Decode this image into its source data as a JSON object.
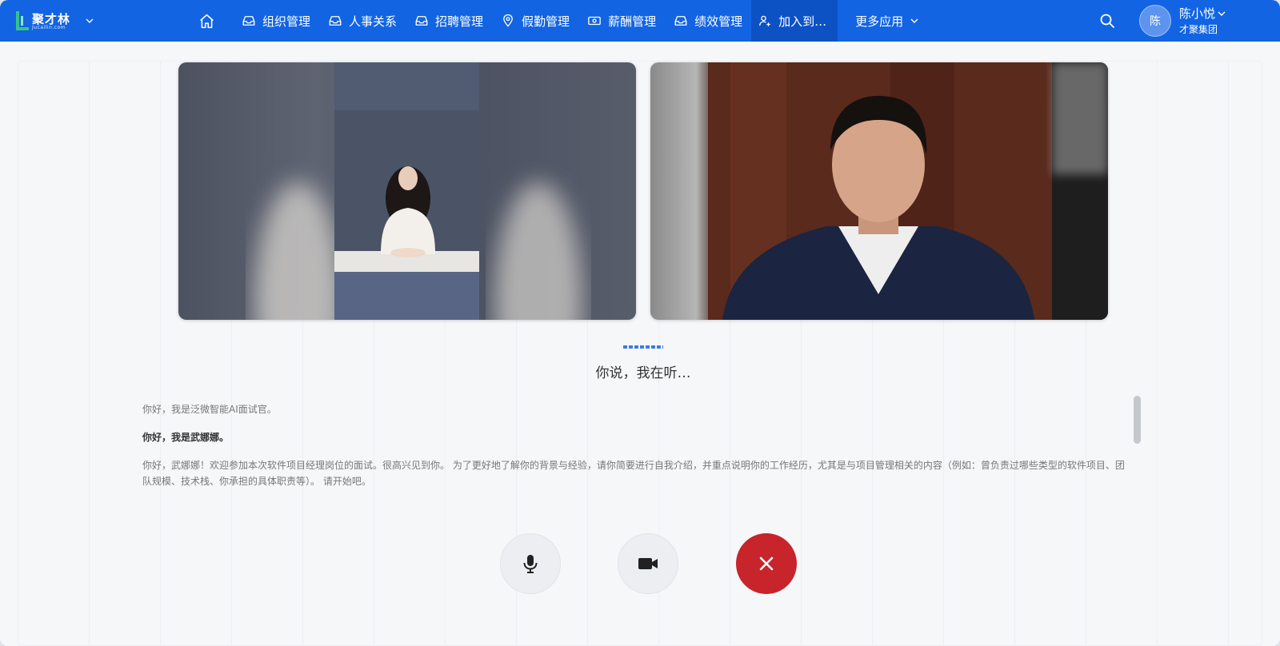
{
  "app": {
    "logo_cn": "聚才林",
    "logo_en": "Jucailin.com"
  },
  "nav": {
    "items": [
      {
        "label": "组织管理",
        "icon": "inbox-icon"
      },
      {
        "label": "人事关系",
        "icon": "inbox-icon"
      },
      {
        "label": "招聘管理",
        "icon": "inbox-icon"
      },
      {
        "label": "假勤管理",
        "icon": "location-pin-icon"
      },
      {
        "label": "薪酬管理",
        "icon": "money-icon"
      },
      {
        "label": "绩效管理",
        "icon": "inbox-icon"
      },
      {
        "label": "加入到…",
        "icon": "user-add-icon",
        "active": true
      }
    ],
    "more_label": "更多应用"
  },
  "user": {
    "avatar_text": "陈",
    "name": "陈小悦",
    "org": "才聚集团"
  },
  "interview": {
    "status_text": "你说，我在听…",
    "messages": [
      {
        "role": "ai",
        "text": "你好，我是泛微智能AI面试官。"
      },
      {
        "role": "user",
        "text": "你好，我是武娜娜。"
      },
      {
        "role": "ai",
        "text": "你好，武娜娜！欢迎参加本次软件项目经理岗位的面试。很高兴见到你。 为了更好地了解你的背景与经验，请你简要进行自我介绍，并重点说明你的工作经历，尤其是与项目管理相关的内容（例如：曾负责过哪些类型的软件项目、团队规模、技术栈、你承担的具体职责等）。 请开始吧。"
      }
    ]
  },
  "controls": {
    "mic_icon": "microphone-icon",
    "camera_icon": "video-camera-icon",
    "hangup_icon": "close-icon"
  },
  "colors": {
    "brand": "#1264e3",
    "hangup": "#c8242b",
    "listening": "#3c7be8"
  }
}
